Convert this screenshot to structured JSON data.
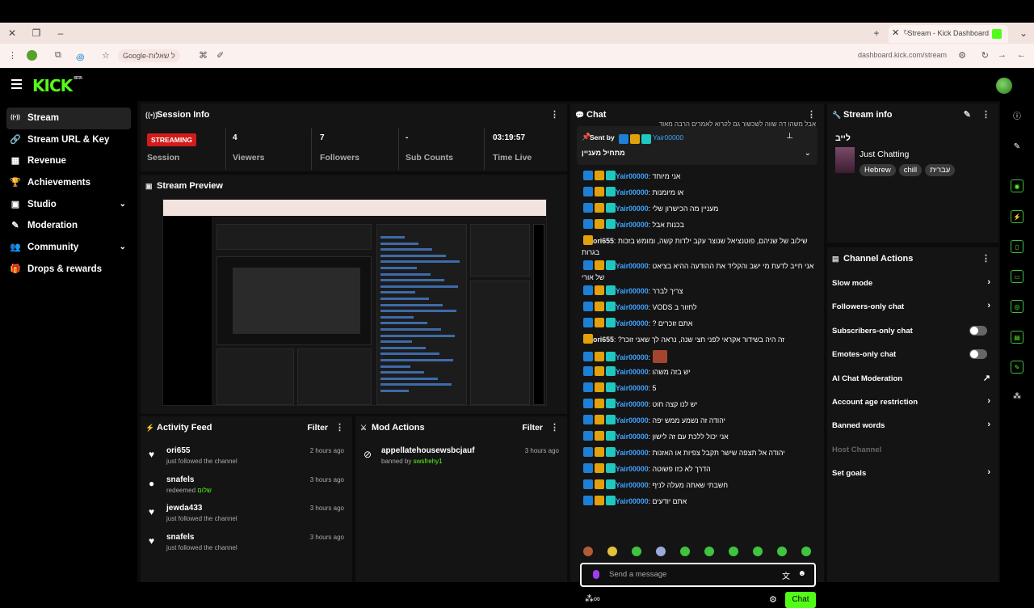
{
  "browser": {
    "tab_title": "Stream - Kick Dashboard",
    "url": "dashboard.kick.com/stream",
    "search_pill": "Google-ל שאלות"
  },
  "app": {
    "logo": "KICK",
    "logo_badge": "BETA"
  },
  "sidebar": {
    "items": [
      {
        "label": "Stream",
        "icon": "broadcast-icon",
        "glyph": "((•))",
        "active": true
      },
      {
        "label": "Stream URL & Key",
        "icon": "link-icon",
        "glyph": "🔗"
      },
      {
        "label": "Revenue",
        "icon": "chart-icon",
        "glyph": "▦"
      },
      {
        "label": "Achievements",
        "icon": "trophy-icon",
        "glyph": "🏆"
      },
      {
        "label": "Studio",
        "icon": "studio-icon",
        "glyph": "▣",
        "expand": "⌄"
      },
      {
        "label": "Moderation",
        "icon": "wrench-icon",
        "glyph": "✎"
      },
      {
        "label": "Community",
        "icon": "people-icon",
        "glyph": "👥",
        "expand": "⌄"
      },
      {
        "label": "Drops & rewards",
        "icon": "gift-icon",
        "glyph": "🎁"
      }
    ]
  },
  "session": {
    "title": "Session Info",
    "status_badge": "STREAMING",
    "stats": [
      {
        "value": "",
        "label": "Session"
      },
      {
        "value": "4",
        "label": "Viewers"
      },
      {
        "value": "7",
        "label": "Followers"
      },
      {
        "value": "-",
        "label": "Sub Counts"
      },
      {
        "value": "03:19:57",
        "label": "Time Live"
      }
    ]
  },
  "preview": {
    "title": "Stream Preview"
  },
  "activity": {
    "title": "Activity Feed",
    "filter": "Filter",
    "items": [
      {
        "name": "ori655",
        "sub": "just followed the channel",
        "time": "2 hours ago",
        "icon": "heart-icon",
        "glyph": "♥"
      },
      {
        "name": "snafels",
        "sub": "redeemed",
        "extra": "שלום",
        "time": "3 hours ago",
        "icon": "points-icon",
        "glyph": "●"
      },
      {
        "name": "jewda433",
        "sub": "just followed the channel",
        "time": "3 hours ago",
        "icon": "heart-icon",
        "glyph": "♥"
      },
      {
        "name": "snafels",
        "sub": "just followed the channel",
        "time": "3 hours ago",
        "icon": "heart-icon",
        "glyph": "♥"
      }
    ]
  },
  "mod": {
    "title": "Mod Actions",
    "filter": "Filter",
    "items": [
      {
        "name": "appellatehousewsbcjauf",
        "sub": "banned by",
        "by": "swsfrehy1",
        "time": "3 hours ago"
      }
    ]
  },
  "chat": {
    "title": "Chat",
    "pinned": {
      "sent_by": "Sent by",
      "user": "Yair00000",
      "text": "מתחיל מעניין"
    },
    "top_line": "אבל משהו דה שווה לשכשוך גם לקרוא לאמרים הרבה מאוד",
    "messages": [
      {
        "user": "Yair00000",
        "text": "אני מיוחד",
        "badges": 3
      },
      {
        "user": "Yair00000",
        "text": "או מיומנות",
        "badges": 3
      },
      {
        "user": "Yair00000",
        "text": "מעניין מה הכישרון שלי",
        "badges": 3
      },
      {
        "user": "Yair00000",
        "text": "בכנות אבל",
        "badges": 3
      },
      {
        "user": "ori655",
        "text": "שילוב של שניהם, פוטנציאל שנוצר עקב ילדות קשה, ומומש בזכות בגרות",
        "badges": 1
      },
      {
        "user": "Yair00000",
        "text": "אני חייב לדעת מי ישב והקליד את ההודעה ההיא בציאט של אורי",
        "badges": 3
      },
      {
        "user": "Yair00000",
        "text": "צריך לברר",
        "badges": 3
      },
      {
        "user": "Yair00000",
        "text": "לחזור ב VODS",
        "badges": 3
      },
      {
        "user": "Yair00000",
        "text": "אתם זוכרים ?",
        "badges": 3
      },
      {
        "user": "ori655",
        "text": "זה היה בשידור אקראי לפני חצי שנה, נראה לך שאני זוכר?",
        "badges": 1
      },
      {
        "user": "Yair00000",
        "text": "",
        "badges": 3,
        "emote": true
      },
      {
        "user": "Yair00000",
        "text": "יש בזה משהו",
        "badges": 3
      },
      {
        "user": "Yair00000",
        "text": "5",
        "badges": 3
      },
      {
        "user": "Yair00000",
        "text": "יש לנו קצה חוט",
        "badges": 3
      },
      {
        "user": "Yair00000",
        "text": "יהודה זה נשמע ממש יפה",
        "badges": 3
      },
      {
        "user": "Yair00000",
        "text": "אני יכול ללכת עם זה לישון",
        "badges": 3
      },
      {
        "user": "Yair00000",
        "text": "יהודה אל תצפה שישר תקבל צפיות או האזנות",
        "badges": 3
      },
      {
        "user": "Yair00000",
        "text": "הדרך לא כזו פשוטה",
        "badges": 3
      },
      {
        "user": "Yair00000",
        "text": "חשבתי שאתה מעלה לניף",
        "badges": 3
      },
      {
        "user": "Yair00000",
        "text": "אתם יודעים",
        "badges": 3
      }
    ],
    "input_placeholder": "Send a message",
    "send_label": "Chat"
  },
  "stream_info": {
    "title": "Stream info",
    "stream_title": "לייב",
    "category": "Just Chatting",
    "tags": [
      "Hebrew",
      "chill",
      "עברית"
    ]
  },
  "channel_actions": {
    "title": "Channel Actions",
    "items": [
      {
        "label": "Slow mode",
        "control": "arrow"
      },
      {
        "label": "Followers-only chat",
        "control": "arrow"
      },
      {
        "label": "Subscribers-only chat",
        "control": "toggle",
        "value": false
      },
      {
        "label": "Emotes-only chat",
        "control": "toggle",
        "value": false
      },
      {
        "label": "AI Chat Moderation",
        "control": "external"
      },
      {
        "label": "Account age restriction",
        "control": "arrow"
      },
      {
        "label": "Banned words",
        "control": "arrow"
      },
      {
        "label": "Host Channel",
        "control": "none",
        "disabled": true
      },
      {
        "label": "Set goals",
        "control": "arrow"
      }
    ]
  },
  "colors": {
    "accent": "#53fc18",
    "streaming": "#d11c1c",
    "panel": "#141414"
  }
}
